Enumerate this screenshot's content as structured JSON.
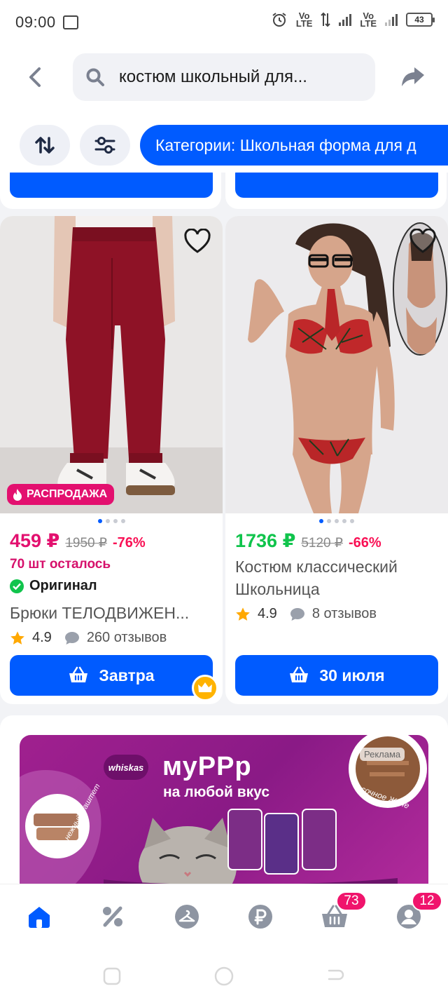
{
  "status_bar": {
    "time": "09:00",
    "battery": "43"
  },
  "search": {
    "query": "костюм школьный для..."
  },
  "filters": {
    "category_chip": "Категории: Школьная форма для д"
  },
  "products": [
    {
      "price": "459 ₽",
      "old_price": "1950 ₽",
      "discount": "-76%",
      "stock": "70 шт осталось",
      "original_label": "Оригинал",
      "title": "Брюки ТЕЛОДВИЖЕН...",
      "rating": "4.9",
      "reviews": "260 отзывов",
      "delivery": "Завтра",
      "badge": "РАСПРОДАЖА",
      "price_color": "#e3106f"
    },
    {
      "price": "1736 ₽",
      "old_price": "5120 ₽",
      "discount": "-66%",
      "title": "Костюм классический Школьница",
      "rating": "4.9",
      "reviews": "8 отзывов",
      "delivery": "30 июля",
      "price_color": "#10c44c"
    }
  ],
  "ad": {
    "brand": "whiskas",
    "headline": "муРРр",
    "subline": "на любой вкус",
    "label": "Реклама",
    "tag_left": "нежный Паштет",
    "tag_right": "сочное Желе"
  },
  "bottom_nav": {
    "items": [
      "home-icon",
      "percent-icon",
      "catalog-icon",
      "ruble-icon",
      "cart-icon",
      "profile-icon"
    ],
    "cart_badge": "73",
    "profile_badge": "12",
    "active_color": "#005bff"
  },
  "colors": {
    "accent": "#005bff",
    "sale": "#e3106f"
  }
}
